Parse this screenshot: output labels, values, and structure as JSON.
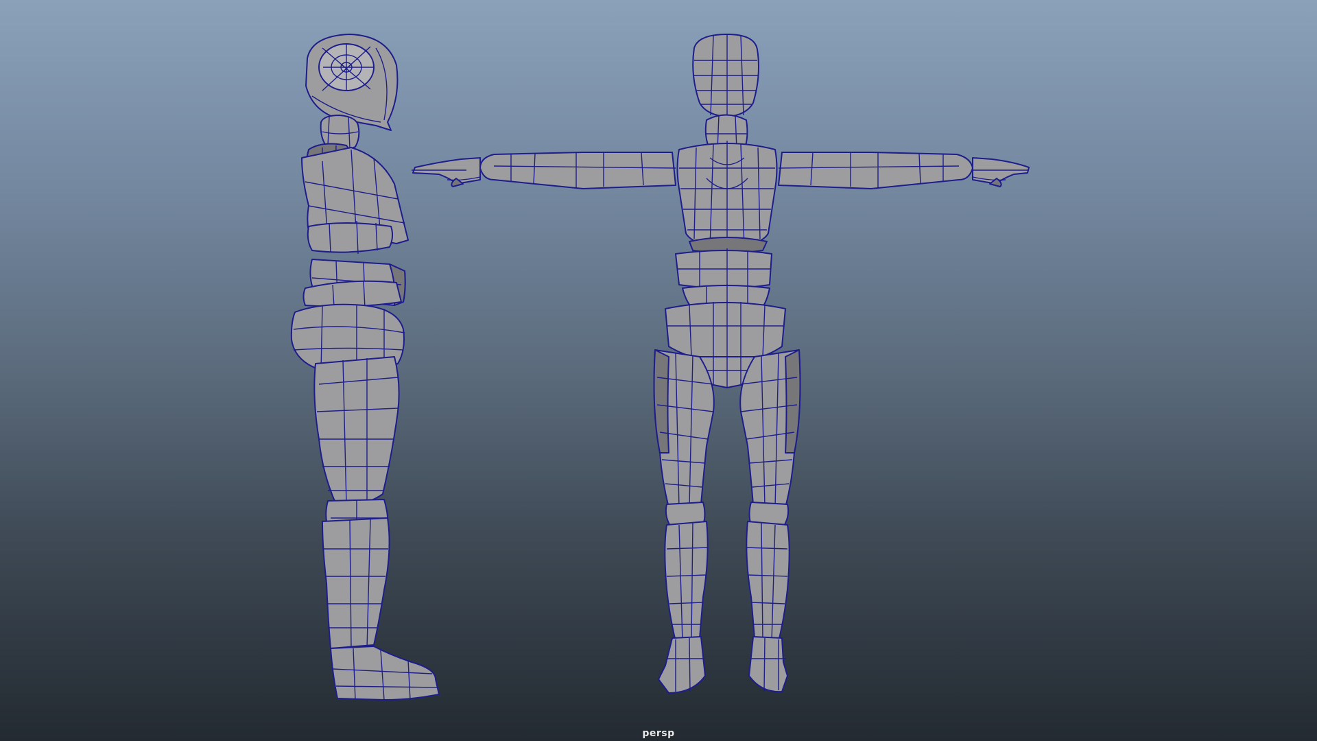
{
  "viewport": {
    "camera_name": "persp",
    "background_top": "#8aa1b9",
    "background_bottom": "#232a31",
    "wireframe_color": "#1d1d8c",
    "shaded_color": "#9d9d9f"
  },
  "models": [
    {
      "name": "character-side-view",
      "view": "side"
    },
    {
      "name": "character-front-view",
      "view": "front",
      "pose": "T-pose"
    }
  ]
}
